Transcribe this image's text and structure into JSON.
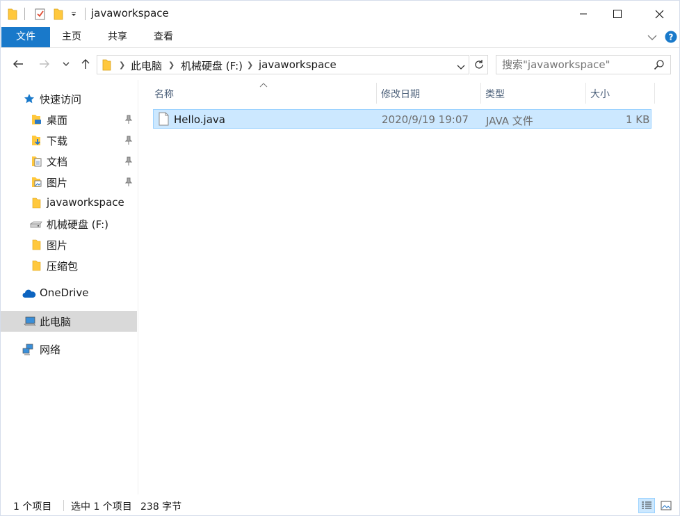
{
  "window": {
    "title": "javaworkspace"
  },
  "ribbon": {
    "tabs": [
      {
        "label": "文件"
      },
      {
        "label": "主页"
      },
      {
        "label": "共享"
      },
      {
        "label": "查看"
      }
    ]
  },
  "address": {
    "crumbs": [
      "此电脑",
      "机械硬盘 (F:)",
      "javaworkspace"
    ]
  },
  "search": {
    "placeholder": "搜索\"javaworkspace\""
  },
  "nav": {
    "quick_access": "快速访问",
    "items": [
      {
        "label": "桌面",
        "icon": "desktop-folder-icon",
        "pinned": true
      },
      {
        "label": "下载",
        "icon": "download-folder-icon",
        "pinned": true
      },
      {
        "label": "文档",
        "icon": "documents-folder-icon",
        "pinned": true
      },
      {
        "label": "图片",
        "icon": "pictures-folder-icon",
        "pinned": true
      },
      {
        "label": "javaworkspace",
        "icon": "folder-icon",
        "pinned": false
      },
      {
        "label": "机械硬盘 (F:)",
        "icon": "drive-icon",
        "pinned": false
      },
      {
        "label": "图片",
        "icon": "folder-icon",
        "pinned": false
      },
      {
        "label": "压缩包",
        "icon": "folder-icon",
        "pinned": false
      }
    ],
    "onedrive": "OneDrive",
    "this_pc": "此电脑",
    "network": "网络"
  },
  "columns": {
    "name": "名称",
    "date": "修改日期",
    "type": "类型",
    "size": "大小"
  },
  "files": [
    {
      "name": "Hello.java",
      "date": "2020/9/19 19:07",
      "type": "JAVA 文件",
      "size": "1 KB"
    }
  ],
  "status": {
    "count": "1 个项目",
    "selection": "选中 1 个项目",
    "bytes": "238 字节"
  },
  "colors": {
    "accent": "#1979ca",
    "selection": "#cce8ff",
    "selection_border": "#99d1ff",
    "header_text": "#4c607a"
  }
}
